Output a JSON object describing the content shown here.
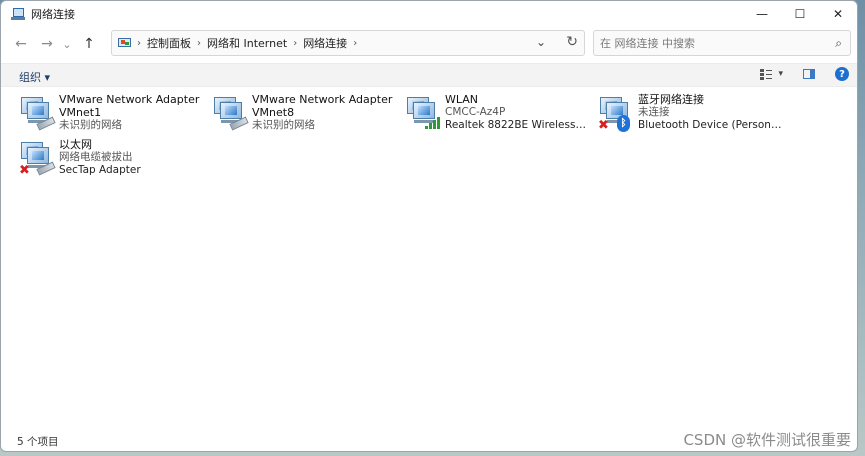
{
  "window": {
    "title": "网络连接",
    "minimize": "—",
    "maximize": "☐",
    "close": "✕"
  },
  "nav": {
    "back": "←",
    "forward": "→",
    "recent": "⌄",
    "up": "↑"
  },
  "address": {
    "crumbs": [
      "控制面板",
      "网络和 Internet",
      "网络连接"
    ],
    "sep": "›"
  },
  "search": {
    "placeholder": "在 网络连接 中搜索"
  },
  "commandbar": {
    "organize": "组织 ▾"
  },
  "items": [
    {
      "name": "VMware Network Adapter VMnet1",
      "line1": "VMware Network Adapter",
      "line2": "VMnet1",
      "status": "未识别的网络",
      "icon": "network-adapter-icon"
    },
    {
      "name": "VMware Network Adapter VMnet8",
      "line1": "VMware Network Adapter",
      "line2": "VMnet8",
      "status": "未识别的网络",
      "icon": "network-adapter-icon"
    },
    {
      "line1": "WLAN",
      "line2": "CMCC-Az4P",
      "status": "Realtek 8822BE Wireless LAN ...",
      "icon": "wifi-adapter-icon"
    },
    {
      "line1": "蓝牙网络连接",
      "line2": "未连接",
      "status": "Bluetooth Device (Personal Ar...",
      "icon": "bluetooth-adapter-icon"
    },
    {
      "line1": "以太网",
      "line2": "网络电缆被拔出",
      "status": "SecTap Adapter",
      "icon": "ethernet-disconnected-icon"
    }
  ],
  "statusbar": {
    "count": "5 个项目"
  },
  "watermark": "CSDN @软件测试很重要"
}
